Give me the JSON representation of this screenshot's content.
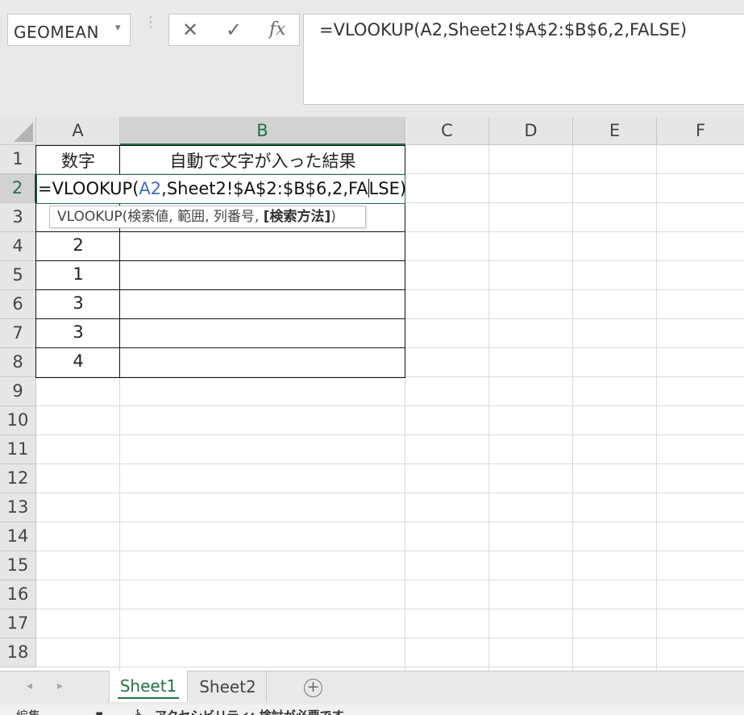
{
  "name_box": {
    "value": "GEOMEAN"
  },
  "formula_bar": {
    "cancel_icon": "✕",
    "enter_icon": "✓",
    "fx_label": "fx",
    "formula": "=VLOOKUP(A2,Sheet2!$A$2:$B$6,2,FALSE)"
  },
  "columns": [
    "A",
    "B",
    "C",
    "D",
    "E",
    "F"
  ],
  "rows": [
    "1",
    "2",
    "3",
    "4",
    "5",
    "6",
    "7",
    "8",
    "9",
    "10",
    "11",
    "12",
    "13",
    "14",
    "15",
    "16",
    "17",
    "18"
  ],
  "cells": {
    "A1": "数字",
    "B1": "自動で文字が入った結果",
    "A4": "2",
    "A5": "1",
    "A6": "3",
    "A7": "3",
    "A8": "4"
  },
  "edit": {
    "prefix": "=VLOOKUP(",
    "ref": "A2",
    "middle": ",Sheet2!$A$2:$B$6,2,FA",
    "suffix": "LSE)"
  },
  "tooltip": {
    "fn": "VLOOKUP(",
    "args": "検索値, 範囲, 列番号, ",
    "bold_arg": "[検索方法]",
    "close": ")"
  },
  "sheet_tabs": [
    "Sheet1",
    "Sheet2"
  ],
  "active_sheet": "Sheet1",
  "status": {
    "mode": "編集",
    "accessibility": "アクセシビリティ: 検討が必要です"
  },
  "colors": {
    "accent": "#217346",
    "reference": "#3a6fc8"
  }
}
